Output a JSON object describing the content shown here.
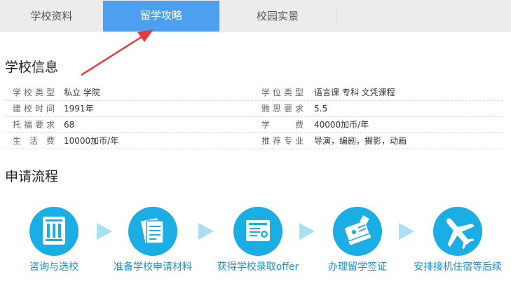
{
  "tabs": [
    {
      "label": "学校资料"
    },
    {
      "label": "留学攻略"
    },
    {
      "label": "校园实景"
    }
  ],
  "active_tab": "留学攻略",
  "school_info": {
    "title": "学校信息",
    "rows": [
      {
        "left_label": "学校类型",
        "left_value": "私立 学院",
        "right_label": "学位类型",
        "right_value": "语言课 专科 文凭课程"
      },
      {
        "left_label": "建校时间",
        "left_value": "1991年",
        "right_label": "雅思要求",
        "right_value": "5.5"
      },
      {
        "left_label": "托福要求",
        "left_value": "68",
        "right_label": "学　　费",
        "right_value": "40000加币/年"
      },
      {
        "left_label": "生 活 费",
        "left_value": "10000加币/年",
        "right_label": "推荐专业",
        "right_value": "导演，编剧，摄影，动画"
      }
    ]
  },
  "process": {
    "title": "申请流程",
    "steps": [
      {
        "label": "咨询与选校",
        "icon": "building-columns-icon"
      },
      {
        "label": "准备学校申请材料",
        "icon": "documents-icon"
      },
      {
        "label": "获得学校录取offer",
        "icon": "certificate-icon"
      },
      {
        "label": "办理留学签证",
        "icon": "passport-icon"
      },
      {
        "label": "安排接机住宿等后续",
        "icon": "airplane-icon"
      }
    ]
  },
  "colors": {
    "active_tab": "#4f9ff0",
    "step_circle": "#1aaee4",
    "step_label": "#1a8fd1",
    "chevron": "#a8dff3",
    "annotation_arrow": "#e8393a"
  }
}
